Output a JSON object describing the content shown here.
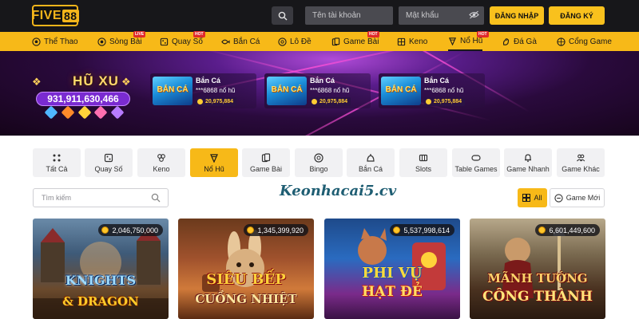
{
  "header": {
    "logo_text": "FIVE",
    "logo_num": "88",
    "username_placeholder": "Tên tài khoản",
    "password_placeholder": "Mật khẩu",
    "login_label": "ĐĂNG NHẬP",
    "register_label": "ĐĂNG KÝ"
  },
  "nav": {
    "items": [
      {
        "label": "Thể Thao",
        "icon": "soccer-ball-icon"
      },
      {
        "label": "Sòng Bài",
        "icon": "casino-chip-icon",
        "tag": "LIVE"
      },
      {
        "label": "Quay Số",
        "icon": "lottery-icon",
        "tag": "HOT"
      },
      {
        "label": "Bắn Cá",
        "icon": "fish-icon"
      },
      {
        "label": "Lô Đề",
        "icon": "lottery-ball-icon"
      },
      {
        "label": "Game Bài",
        "icon": "cards-icon",
        "tag": "HOT"
      },
      {
        "label": "Keno",
        "icon": "keno-icon"
      },
      {
        "label": "Nổ Hũ",
        "icon": "slot-icon",
        "tag": "HOT"
      },
      {
        "label": "Đá Gà",
        "icon": "rooster-icon"
      },
      {
        "label": "Cổng Game",
        "icon": "gamepad-icon"
      }
    ]
  },
  "jackpot": {
    "title": "HŨ XU",
    "amount": "931,911,630,466",
    "cards": [
      {
        "name": "Bắn Cá",
        "thumb_text": "BẮN CÁ",
        "user": "***6868 nổ hũ",
        "value": "20,975,884"
      },
      {
        "name": "Bắn Cá",
        "thumb_text": "BẮN CÁ",
        "user": "***6868 nổ hũ",
        "value": "20,975,884"
      },
      {
        "name": "Bắn Cá",
        "thumb_text": "BẮN CÁ",
        "user": "***6868 nổ hũ",
        "value": "20,975,884"
      }
    ]
  },
  "categories": [
    {
      "label": "Tất Cả"
    },
    {
      "label": "Quay Số"
    },
    {
      "label": "Keno"
    },
    {
      "label": "Nổ Hũ"
    },
    {
      "label": "Game Bài"
    },
    {
      "label": "Bingo"
    },
    {
      "label": "Bắn Cá"
    },
    {
      "label": "Slots"
    },
    {
      "label": "Table Games"
    },
    {
      "label": "Game Nhanh"
    },
    {
      "label": "Game Khác"
    }
  ],
  "search": {
    "placeholder": "Tìm kiếm"
  },
  "watermark": "Keonhacai5.cv",
  "filters": {
    "all_label": "All",
    "new_label": "Game Mới"
  },
  "games": [
    {
      "jackpot": "2,046,750,000",
      "title_line1": "KNIGHTS",
      "title_line2": "& DRAGON"
    },
    {
      "jackpot": "1,345,399,920",
      "title_line1": "SIÊU BẾP",
      "title_line2": "CUỒNG NHIỆT"
    },
    {
      "jackpot": "5,537,998,614",
      "title_line1": "PHI VỤ",
      "title_line2": "HẠT ĐẺ"
    },
    {
      "jackpot": "6,601,449,600",
      "title_line1": "MÃNH TƯỚNG",
      "title_line2": "CÔNG THÀNH"
    }
  ],
  "colors": {
    "accent": "#f7b918",
    "header_bg": "#17171a",
    "jackpot_purple": "#7a2bd1"
  }
}
